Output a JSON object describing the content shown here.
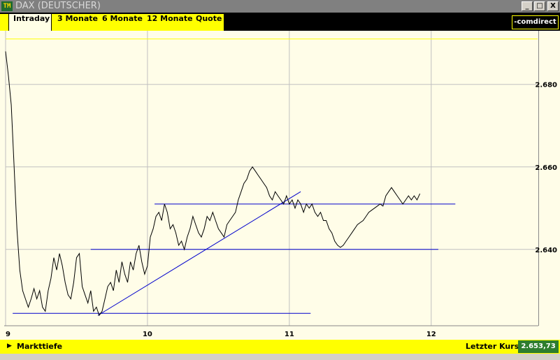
{
  "window": {
    "title": "DAX (DEUTSCHER)",
    "icon_label": "TM",
    "buttons": [
      "_",
      "□",
      "X"
    ]
  },
  "tabs": [
    {
      "label": "Intraday",
      "active": true
    },
    {
      "label": "3 Monate",
      "active": false
    },
    {
      "label": "6 Monate",
      "active": false
    },
    {
      "label": "12 Monate",
      "active": false
    },
    {
      "label": "Quote",
      "active": false
    }
  ],
  "logo": {
    "text": "-comdirect"
  },
  "footer": {
    "left_label": "Markttiefe",
    "right_label": "Letzter Kurs",
    "last_price": "2.653,73"
  },
  "colors": {
    "price_line": "#000000",
    "trend_lines": "#0000cc",
    "grid": "#c0c0c0",
    "highlight_line": "#ffff00",
    "panel_bg": "#fffde8",
    "accent": "#ffff00"
  },
  "chart_data": {
    "type": "line",
    "x_ticks": [
      "9",
      "10",
      "11",
      "12"
    ],
    "y_ticks": [
      "2.640",
      "2.660",
      "2.680"
    ],
    "xlim": [
      9.0,
      12.75
    ],
    "ylim": [
      2621.5,
      2693.0
    ],
    "grid": true,
    "series": [
      {
        "values": [
          [
            9.0,
            2688.0
          ],
          [
            9.02,
            2682.0
          ],
          [
            9.04,
            2675.0
          ],
          [
            9.06,
            2660.0
          ],
          [
            9.08,
            2645.0
          ],
          [
            9.1,
            2635.0
          ],
          [
            9.12,
            2630.0
          ],
          [
            9.14,
            2628.0
          ],
          [
            9.16,
            2626.0
          ],
          [
            9.18,
            2628.0
          ],
          [
            9.2,
            2630.5
          ],
          [
            9.22,
            2628.0
          ],
          [
            9.24,
            2630.0
          ],
          [
            9.26,
            2626.0
          ],
          [
            9.28,
            2625.0
          ],
          [
            9.3,
            2630.0
          ],
          [
            9.32,
            2633.0
          ],
          [
            9.34,
            2638.0
          ],
          [
            9.36,
            2635.0
          ],
          [
            9.38,
            2639.0
          ],
          [
            9.4,
            2636.0
          ],
          [
            9.42,
            2632.0
          ],
          [
            9.44,
            2629.0
          ],
          [
            9.46,
            2628.0
          ],
          [
            9.48,
            2632.0
          ],
          [
            9.5,
            2638.0
          ],
          [
            9.52,
            2639.0
          ],
          [
            9.54,
            2631.0
          ],
          [
            9.56,
            2629.0
          ],
          [
            9.58,
            2627.0
          ],
          [
            9.6,
            2630.0
          ],
          [
            9.62,
            2625.0
          ],
          [
            9.64,
            2626.0
          ],
          [
            9.66,
            2624.0
          ],
          [
            9.68,
            2625.0
          ],
          [
            9.7,
            2628.0
          ],
          [
            9.72,
            2631.0
          ],
          [
            9.74,
            2632.0
          ],
          [
            9.76,
            2630.0
          ],
          [
            9.78,
            2635.0
          ],
          [
            9.8,
            2632.0
          ],
          [
            9.82,
            2637.0
          ],
          [
            9.84,
            2634.0
          ],
          [
            9.86,
            2632.0
          ],
          [
            9.88,
            2637.0
          ],
          [
            9.9,
            2635.0
          ],
          [
            9.92,
            2639.0
          ],
          [
            9.94,
            2641.0
          ],
          [
            9.96,
            2637.0
          ],
          [
            9.98,
            2634.0
          ],
          [
            10.0,
            2636.0
          ],
          [
            10.02,
            2643.0
          ],
          [
            10.04,
            2645.0
          ],
          [
            10.06,
            2648.0
          ],
          [
            10.08,
            2649.0
          ],
          [
            10.1,
            2647.0
          ],
          [
            10.12,
            2651.0
          ],
          [
            10.14,
            2649.0
          ],
          [
            10.16,
            2645.0
          ],
          [
            10.18,
            2646.0
          ],
          [
            10.2,
            2644.0
          ],
          [
            10.22,
            2641.0
          ],
          [
            10.24,
            2642.0
          ],
          [
            10.26,
            2640.0
          ],
          [
            10.28,
            2643.0
          ],
          [
            10.3,
            2645.0
          ],
          [
            10.32,
            2648.0
          ],
          [
            10.34,
            2646.0
          ],
          [
            10.36,
            2644.0
          ],
          [
            10.38,
            2643.0
          ],
          [
            10.4,
            2645.0
          ],
          [
            10.42,
            2648.0
          ],
          [
            10.44,
            2647.0
          ],
          [
            10.46,
            2649.0
          ],
          [
            10.48,
            2647.0
          ],
          [
            10.5,
            2645.0
          ],
          [
            10.52,
            2644.0
          ],
          [
            10.54,
            2643.0
          ],
          [
            10.56,
            2646.0
          ],
          [
            10.58,
            2647.0
          ],
          [
            10.6,
            2648.0
          ],
          [
            10.62,
            2649.0
          ],
          [
            10.64,
            2652.0
          ],
          [
            10.66,
            2654.0
          ],
          [
            10.68,
            2656.0
          ],
          [
            10.7,
            2657.0
          ],
          [
            10.72,
            2659.0
          ],
          [
            10.74,
            2660.0
          ],
          [
            10.76,
            2659.0
          ],
          [
            10.78,
            2658.0
          ],
          [
            10.8,
            2657.0
          ],
          [
            10.82,
            2656.0
          ],
          [
            10.84,
            2655.0
          ],
          [
            10.86,
            2653.0
          ],
          [
            10.88,
            2652.0
          ],
          [
            10.9,
            2654.0
          ],
          [
            10.92,
            2653.0
          ],
          [
            10.94,
            2652.0
          ],
          [
            10.96,
            2651.0
          ],
          [
            10.98,
            2653.0
          ],
          [
            11.0,
            2651.0
          ],
          [
            11.02,
            2652.0
          ],
          [
            11.04,
            2650.0
          ],
          [
            11.06,
            2652.0
          ],
          [
            11.08,
            2651.0
          ],
          [
            11.1,
            2649.0
          ],
          [
            11.12,
            2651.0
          ],
          [
            11.14,
            2650.0
          ],
          [
            11.16,
            2651.0
          ],
          [
            11.18,
            2649.0
          ],
          [
            11.2,
            2648.0
          ],
          [
            11.22,
            2649.0
          ],
          [
            11.24,
            2647.0
          ],
          [
            11.26,
            2647.0
          ],
          [
            11.28,
            2645.0
          ],
          [
            11.3,
            2644.0
          ],
          [
            11.32,
            2642.0
          ],
          [
            11.34,
            2641.0
          ],
          [
            11.36,
            2640.5
          ],
          [
            11.38,
            2641.0
          ],
          [
            11.4,
            2642.0
          ],
          [
            11.42,
            2643.0
          ],
          [
            11.44,
            2644.0
          ],
          [
            11.46,
            2645.0
          ],
          [
            11.48,
            2646.0
          ],
          [
            11.5,
            2646.5
          ],
          [
            11.52,
            2647.0
          ],
          [
            11.54,
            2648.0
          ],
          [
            11.56,
            2649.0
          ],
          [
            11.58,
            2649.5
          ],
          [
            11.6,
            2650.0
          ],
          [
            11.62,
            2650.5
          ],
          [
            11.64,
            2651.0
          ],
          [
            11.66,
            2650.5
          ],
          [
            11.68,
            2653.0
          ],
          [
            11.7,
            2654.0
          ],
          [
            11.72,
            2655.0
          ],
          [
            11.74,
            2654.0
          ],
          [
            11.76,
            2653.0
          ],
          [
            11.78,
            2652.0
          ],
          [
            11.8,
            2651.0
          ],
          [
            11.82,
            2652.0
          ],
          [
            11.84,
            2653.0
          ],
          [
            11.86,
            2652.0
          ],
          [
            11.88,
            2653.0
          ],
          [
            11.9,
            2652.0
          ],
          [
            11.92,
            2653.5
          ]
        ]
      }
    ],
    "trend_lines": [
      {
        "from": [
          9.65,
          2624.0
        ],
        "to": [
          11.08,
          2654.0
        ]
      },
      {
        "from": [
          9.05,
          2624.5
        ],
        "to": [
          11.15,
          2624.5
        ]
      },
      {
        "from": [
          9.6,
          2640.0
        ],
        "to": [
          12.05,
          2640.0
        ]
      },
      {
        "from": [
          10.05,
          2651.0
        ],
        "to": [
          12.17,
          2651.0
        ]
      }
    ],
    "highlight_line": {
      "y": 2691.0
    }
  }
}
